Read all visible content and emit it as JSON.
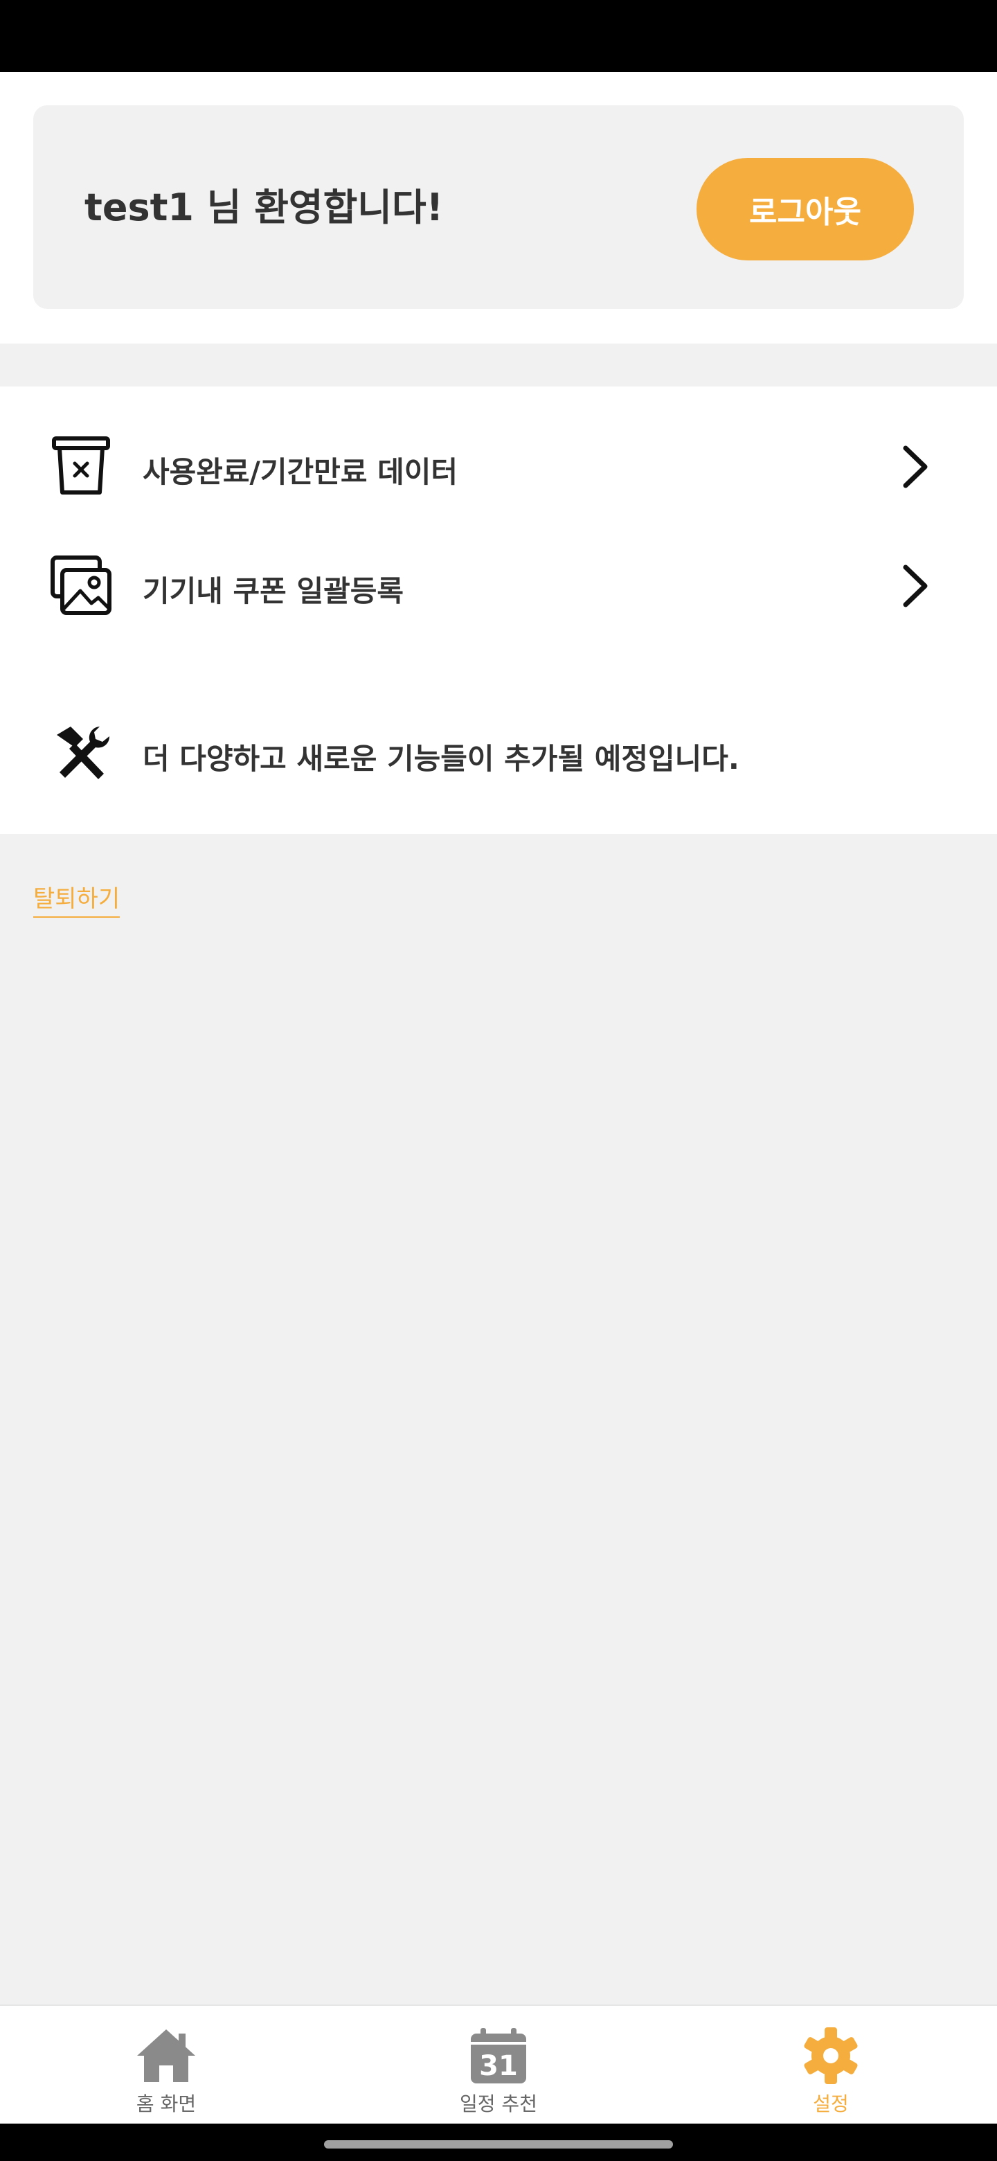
{
  "header": {
    "welcome_text": "test1 님 환영합니다!",
    "logout_label": "로그아웃"
  },
  "menu": {
    "items": [
      {
        "label": "사용완료/기간만료 데이터",
        "icon": "trash-x-icon"
      },
      {
        "label": "기기내 쿠폰 일괄등록",
        "icon": "images-icon"
      }
    ],
    "notice": {
      "label": "더 다양하고 새로운 기능들이 추가될 예정입니다.",
      "icon": "tools-icon"
    }
  },
  "withdraw_label": "탈퇴하기",
  "bottom_nav": {
    "items": [
      {
        "label": "홈 화면",
        "icon": "home-icon",
        "active": false
      },
      {
        "label": "일정 추천",
        "icon": "calendar-icon",
        "calendar_day": "31",
        "active": false
      },
      {
        "label": "설정",
        "icon": "gear-icon",
        "active": true
      }
    ]
  },
  "colors": {
    "accent": "#f5ad3e",
    "background": "#f1f1f1",
    "text": "#333333",
    "nav_inactive": "#8a8a8a"
  }
}
